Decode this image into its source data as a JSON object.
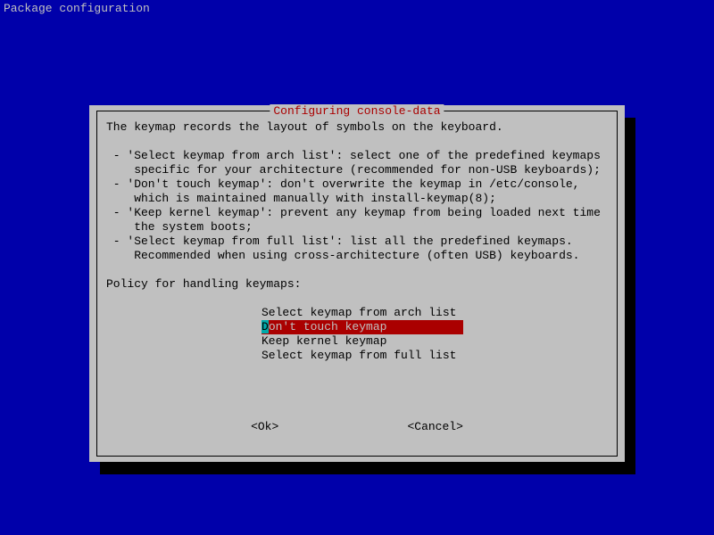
{
  "screen_title": "Package configuration",
  "dialog": {
    "title": " Configuring console-data ",
    "intro": "The keymap records the layout of symbols on the keyboard.",
    "bullets": [
      " - 'Select keymap from arch list': select one of the predefined keymaps\n    specific for your architecture (recommended for non-USB keyboards);",
      " - 'Don't touch keymap': don't overwrite the keymap in /etc/console,\n    which is maintained manually with install-keymap(8);",
      " - 'Keep kernel keymap': prevent any keymap from being loaded next time\n    the system boots;",
      " - 'Select keymap from full list': list all the predefined keymaps.\n    Recommended when using cross-architecture (often USB) keyboards."
    ],
    "prompt": "Policy for handling keymaps:",
    "options": [
      "Select keymap from arch list",
      "Don't touch keymap",
      "Keep kernel keymap",
      "Select keymap from full list"
    ],
    "selected_index": 1,
    "ok_label": "<Ok>",
    "cancel_label": "<Cancel>"
  }
}
